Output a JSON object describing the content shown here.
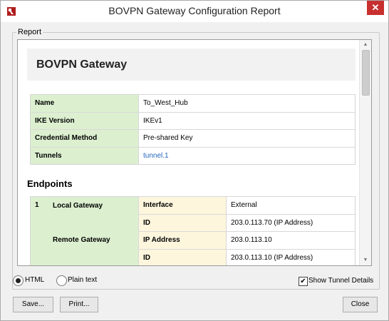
{
  "window": {
    "title": "BOVPN Gateway Configuration Report",
    "close_icon": "close-icon",
    "app_icon": "watchguard-logo-icon"
  },
  "group": {
    "label": "Report"
  },
  "report": {
    "title": "BOVPN Gateway",
    "properties": [
      {
        "key": "Name",
        "value": "To_West_Hub"
      },
      {
        "key": "IKE Version",
        "value": "IKEv1"
      },
      {
        "key": "Credential Method",
        "value": "Pre-shared Key"
      },
      {
        "key": "Tunnels",
        "value": "tunnel.1"
      }
    ],
    "endpoints_title": "Endpoints",
    "endpoints": {
      "index": "1",
      "local_gateway": "Local Gateway",
      "remote_gateway": "Remote Gateway",
      "rows": [
        {
          "attr": "Interface",
          "value": "External"
        },
        {
          "attr": "ID",
          "value": "203.0.113.70 (IP Address)"
        },
        {
          "attr": "IP Address",
          "value": "203.0.113.10"
        },
        {
          "attr": "ID",
          "value": "203.0.113.10 (IP Address)"
        }
      ]
    }
  },
  "format": {
    "html_label": "HTML",
    "plain_label": "Plain text",
    "selected": "HTML"
  },
  "show_tunnel_details": {
    "label": "Show Tunnel Details",
    "checked": true
  },
  "buttons": {
    "save": "Save...",
    "print": "Print...",
    "close": "Close"
  },
  "colors": {
    "key_green": "#dcf0d0",
    "attr_yellow": "#fdf6dd",
    "link": "#2266bb",
    "close_red": "#c7302f"
  }
}
